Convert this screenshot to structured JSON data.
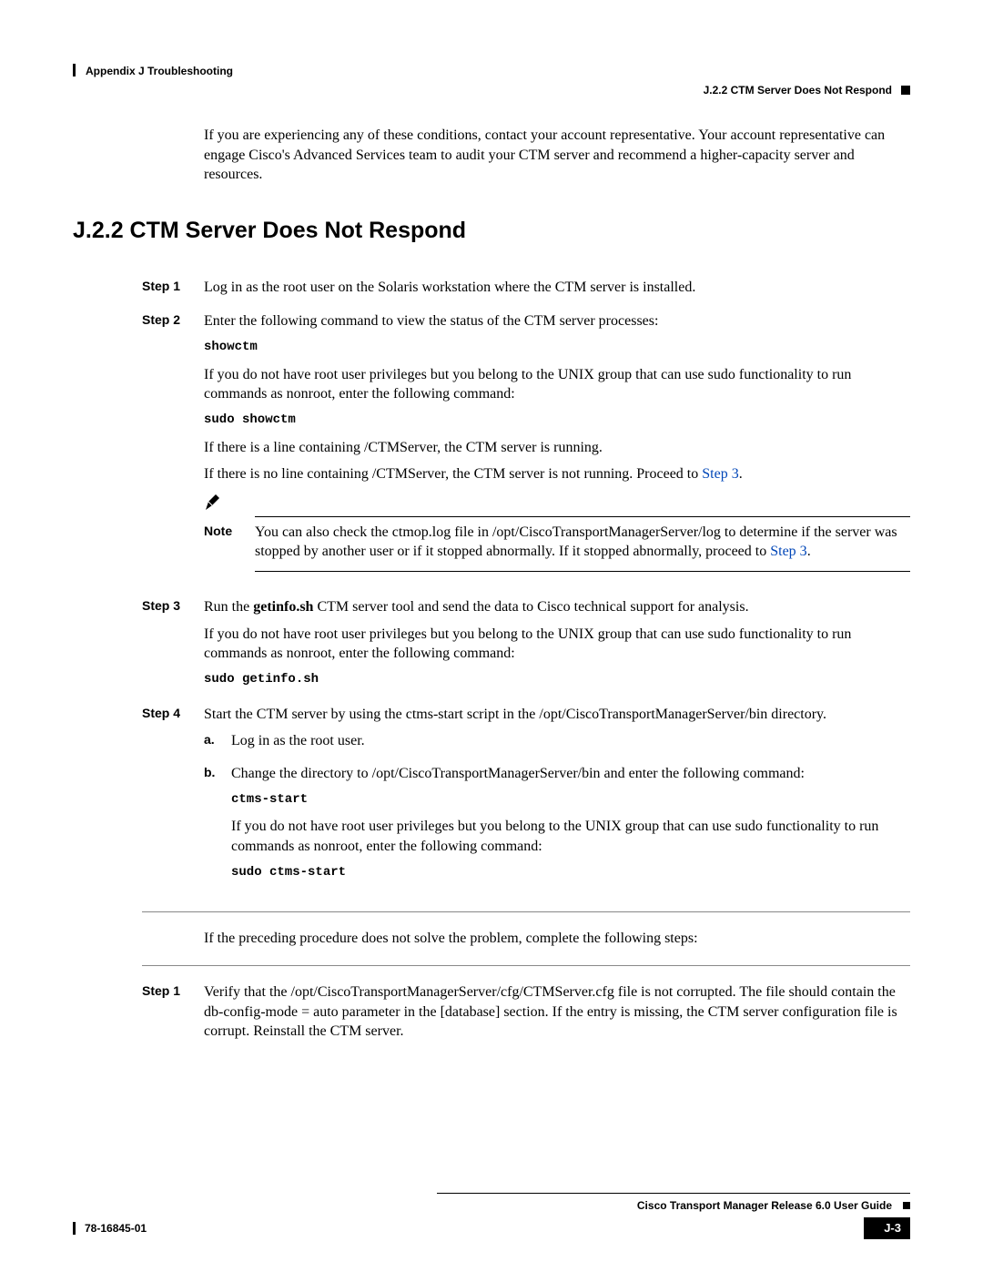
{
  "header": {
    "chapter": "Appendix J      Troubleshooting",
    "section": "J.2.2   CTM Server Does Not Respond"
  },
  "intro": "If you are experiencing any of these conditions, contact your account representative. Your account representative can engage Cisco's Advanced Services team to audit your CTM server and recommend a higher-capacity server and resources.",
  "heading": "J.2.2  CTM Server Does Not Respond",
  "steps_a": [
    {
      "label": "Step 1",
      "paras": [
        "Log in as the root user on the Solaris workstation where the CTM server is installed."
      ]
    },
    {
      "label": "Step 2",
      "paras": [
        "Enter the following command to view the status of the CTM server processes:"
      ],
      "cmd1": "showctm",
      "paras2": [
        "If you do not have root user privileges but you belong to the UNIX group that can use sudo functionality to run commands as nonroot, enter the following command:"
      ],
      "cmd2": "sudo showctm",
      "paras3": [
        "If there is a line containing /CTMServer, the CTM server is running."
      ],
      "paras4_pre": "If there is no line containing /CTMServer, the CTM server is not running. Proceed to ",
      "paras4_link": "Step 3",
      "paras4_post": "."
    }
  ],
  "note": {
    "label": "Note",
    "text_pre": "You can also check the ctmop.log file in /opt/CiscoTransportManagerServer/log to determine if the server was stopped by another user or if it stopped abnormally. If it stopped abnormally, proceed to ",
    "text_link": "Step 3",
    "text_post": "."
  },
  "step3": {
    "label": "Step 3",
    "para1_pre": "Run the ",
    "para1_bold": "getinfo.sh",
    "para1_post": " CTM server tool and send the data to Cisco technical support for analysis.",
    "para2": "If you do not have root user privileges but you belong to the UNIX group that can use sudo functionality to run commands as nonroot, enter the following command:",
    "cmd": "sudo getinfo.sh"
  },
  "step4": {
    "label": "Step 4",
    "para1": "Start the CTM server by using the ctms-start script in the /opt/CiscoTransportManagerServer/bin directory.",
    "sub_a": {
      "label": "a.",
      "text": "Log in as the root user."
    },
    "sub_b": {
      "label": "b.",
      "text": "Change the directory to /opt/CiscoTransportManagerServer/bin and enter the following command:",
      "cmd1": "ctms-start",
      "text2": "If you do not have root user privileges but you belong to the UNIX group that can use sudo functionality to run commands as nonroot, enter the following command:",
      "cmd2": "sudo ctms-start"
    }
  },
  "mid_para": "If the preceding procedure does not solve the problem, complete the following steps:",
  "steps_b": {
    "label": "Step 1",
    "text": "Verify that the /opt/CiscoTransportManagerServer/cfg/CTMServer.cfg file is not corrupted. The file should contain the db-config-mode = auto parameter in the [database] section. If the entry is missing, the CTM server configuration file is corrupt. Reinstall the CTM server."
  },
  "footer": {
    "guide": "Cisco Transport Manager Release 6.0 User Guide",
    "docid": "78-16845-01",
    "pagenum": "J-3"
  }
}
